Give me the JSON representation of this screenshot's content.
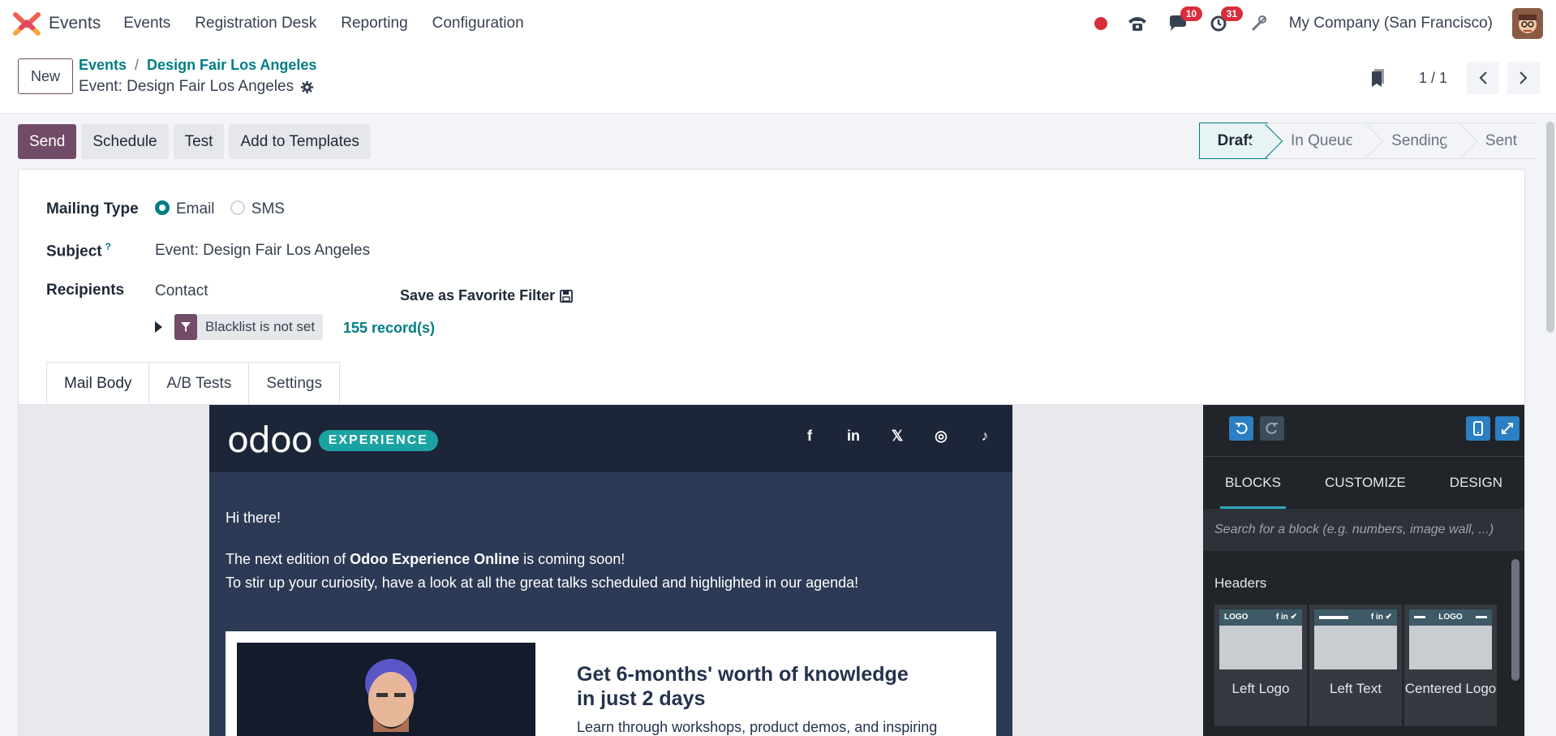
{
  "navbar": {
    "app_name": "Events",
    "menu": [
      "Events",
      "Registration Desk",
      "Reporting",
      "Configuration"
    ],
    "messages_count": "10",
    "activities_count": "31",
    "company": "My Company (San Francisco)"
  },
  "control": {
    "new_label": "New",
    "breadcrumb": [
      "Events",
      "Design Fair Los Angeles"
    ],
    "breadcrumb_sep": "/",
    "record_title": "Event: Design Fair Los Angeles",
    "pager": "1 / 1"
  },
  "actions": {
    "send": "Send",
    "schedule": "Schedule",
    "test": "Test",
    "add_templates": "Add to Templates"
  },
  "status": [
    "Draft",
    "In Queue",
    "Sending",
    "Sent"
  ],
  "status_active": "Draft",
  "form": {
    "mailing_type_label": "Mailing Type",
    "type_email": "Email",
    "type_sms": "SMS",
    "subject_label": "Subject",
    "subject_tip": "?",
    "subject_value": "Event: Design Fair Los Angeles",
    "recipients_label": "Recipients",
    "recipients_value": "Contact",
    "save_filter": "Save as Favorite Filter",
    "filter_tag": "Blacklist is not set",
    "records": "155 record(s)"
  },
  "tabs": [
    "Mail Body",
    "A/B Tests",
    "Settings"
  ],
  "mail": {
    "logo_word": "odoo",
    "logo_pill": "EXPERIENCE",
    "socials": [
      "f",
      "in",
      "𝕏",
      "◎",
      "♪"
    ],
    "greeting": "Hi there!",
    "line1_pre": "The next edition of ",
    "line1_bold": "Odoo Experience Online",
    "line1_post": " is coming soon!",
    "line2": "To stir up your curiosity, have a look at all the great talks scheduled and highlighted in our agenda!",
    "card_title_1": "Get 6-months' worth of knowledge",
    "card_title_2": "in just 2 days",
    "card_body": "Learn through workshops, product demos, and inspiring"
  },
  "snippets": {
    "tabs": [
      "BLOCKS",
      "CUSTOMIZE",
      "DESIGN"
    ],
    "search_placeholder": "Search for a block (e.g. numbers, image wall, ...)",
    "category": "Headers",
    "tiles": [
      {
        "label": "Left Logo",
        "bar": "LOGO"
      },
      {
        "label": "Left Text",
        "bar": ""
      },
      {
        "label": "Centered Logo",
        "bar": "LOGO"
      }
    ],
    "tile_social": "f in ✔"
  },
  "colors": {
    "brand": "#714b67",
    "accent": "#017e84",
    "mail_bg": "#2d3a55",
    "panel_bg": "#212529"
  }
}
